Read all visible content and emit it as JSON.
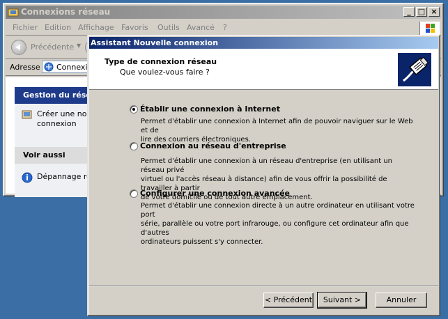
{
  "window": {
    "title": "Connexions réseau",
    "menu": [
      "Fichier",
      "Edition",
      "Affichage",
      "Favoris",
      "Outils",
      "Avancé",
      "?"
    ],
    "back_label": "Précédente",
    "address_label": "Adresse",
    "address_value": "Connexio"
  },
  "sidebar": {
    "panel1_title": "Gestion du résea",
    "panel1_item_line1": "Créer une nou",
    "panel1_item_line2": "connexion",
    "panel2_title": "Voir aussi",
    "panel2_item": "Dépannage ré"
  },
  "wizard": {
    "title": "Assistant Nouvelle connexion",
    "header_title": "Type de connexion réseau",
    "header_subtitle": "Que voulez-vous faire ?",
    "options": [
      {
        "label": "Établir une connexion à Internet",
        "line1": "Permet d'établir une connexion à Internet afin de pouvoir naviguer sur le Web et de",
        "line2": "lire des courriers électroniques.",
        "line3": "",
        "selected": true
      },
      {
        "label": "Connexion au réseau d'entreprise",
        "line1": "Permet d'établir une connexion à un réseau d'entreprise (en utilisant un réseau privé",
        "line2": "virtuel ou l'accès réseau à distance) afin de vous offrir la possibilité de travailler à partir",
        "line3": "de votre domicile ou de tout autre emplacement.",
        "selected": false
      },
      {
        "label": "Configurer une connexion avancée",
        "line1": "Permet d'établir une connexion directe à un autre ordinateur en utilisant votre port",
        "line2": "série, parallèle ou votre port infrarouge, ou configure cet ordinateur afin que d'autres",
        "line3": "ordinateurs puissent s'y connecter.",
        "selected": false
      }
    ],
    "btn_back": "< Précédent",
    "btn_next": "Suivant >",
    "btn_cancel": "Annuler"
  }
}
